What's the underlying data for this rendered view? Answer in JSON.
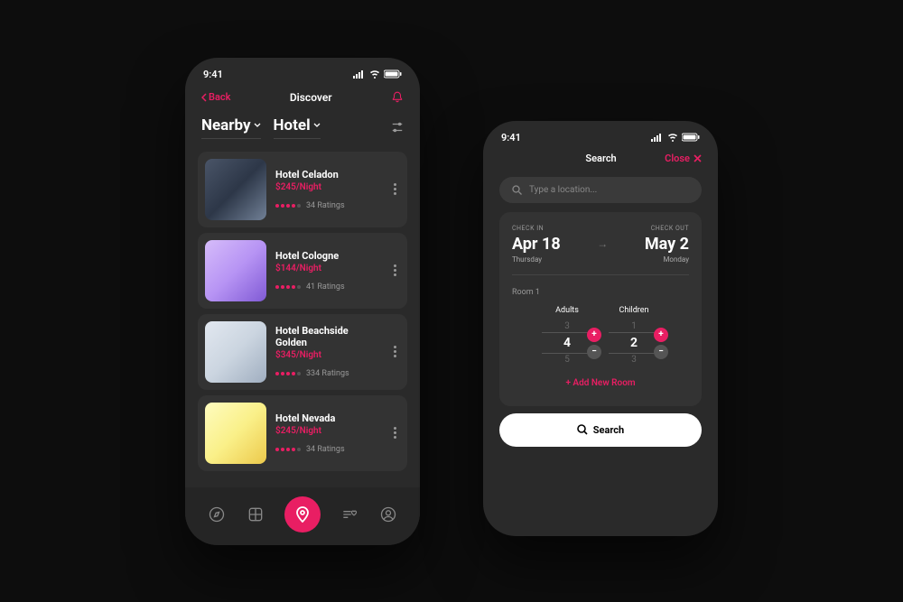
{
  "status_time": "9:41",
  "phone1": {
    "back": "Back",
    "title": "Discover",
    "filter1": "Nearby",
    "filter2": "Hotel",
    "hotels": [
      {
        "name": "Hotel Celadon",
        "price": "$245/Night",
        "ratings": "34 Ratings",
        "stars": 4
      },
      {
        "name": "Hotel Cologne",
        "price": "$144/Night",
        "ratings": "41 Ratings",
        "stars": 4
      },
      {
        "name": "Hotel Beachside Golden",
        "price": "$345/Night",
        "ratings": "334 Ratings",
        "stars": 4
      },
      {
        "name": "Hotel Nevada",
        "price": "$245/Night",
        "ratings": "34 Ratings",
        "stars": 4
      }
    ]
  },
  "phone2": {
    "title": "Search",
    "close": "Close",
    "placeholder": "Type a location...",
    "checkin_label": "CHECK IN",
    "checkin_date": "Apr 18",
    "checkin_day": "Thursday",
    "checkout_label": "CHECK OUT",
    "checkout_date": "May 2",
    "checkout_day": "Monday",
    "room_label": "Room 1",
    "adults_label": "Adults",
    "adults": {
      "prev": "3",
      "current": "4",
      "next": "5"
    },
    "children_label": "Children",
    "children": {
      "prev": "1",
      "current": "2",
      "next": "3"
    },
    "add_room": "+  Add New Room",
    "search_btn": "Search"
  }
}
